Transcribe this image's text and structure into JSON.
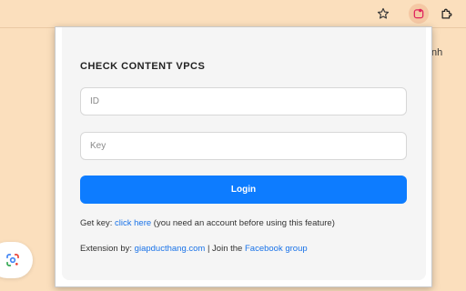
{
  "toolbar": {
    "icons": [
      "star-icon",
      "extension-active-icon",
      "puzzle-icon"
    ],
    "background_text": "nh"
  },
  "popup": {
    "title": "CHECK CONTENT VPCS",
    "id_placeholder": "ID",
    "id_value": "",
    "key_placeholder": "Key",
    "key_value": "",
    "login_label": "Login",
    "get_key": {
      "prefix": "Get key: ",
      "link": "click here",
      "suffix": " (you need an account before using this feature)"
    },
    "extension": {
      "prefix": "Extension by: ",
      "author_link": "giapducthang.com",
      "separator": " | Join the ",
      "group_link": "Facebook group"
    }
  },
  "colors": {
    "page_background": "#fbdfbd",
    "accent": "#0d7cff",
    "link": "#1a73e8"
  }
}
